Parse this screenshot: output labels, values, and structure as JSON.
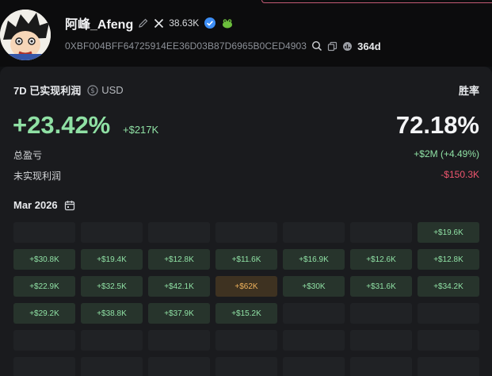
{
  "profile": {
    "name": "阿峰_Afeng",
    "followers": "38.63K",
    "address": "0XBF004BFF64725914EE36D03B87D6965B0CED4903",
    "age": "364d"
  },
  "summary": {
    "period_label": "7D 已实现利润",
    "currency": "USD",
    "pnl_percent": "+23.42%",
    "pnl_amount": "+$217K",
    "winrate_label": "胜率",
    "winrate": "72.18%",
    "total_label": "总盈亏",
    "total_value": "+$2M (+4.49%)",
    "unrealized_label": "未实现利润",
    "unrealized_value": "-$150.3K"
  },
  "calendar": {
    "month": "Mar 2026",
    "cells": [
      {
        "value": ""
      },
      {
        "value": ""
      },
      {
        "value": ""
      },
      {
        "value": ""
      },
      {
        "value": ""
      },
      {
        "value": ""
      },
      {
        "value": "+$19.6K"
      },
      {
        "value": "+$30.8K"
      },
      {
        "value": "+$19.4K"
      },
      {
        "value": "+$12.8K"
      },
      {
        "value": "+$11.6K"
      },
      {
        "value": "+$16.9K"
      },
      {
        "value": "+$12.6K"
      },
      {
        "value": "+$12.8K"
      },
      {
        "value": "+$22.9K"
      },
      {
        "value": "+$32.5K"
      },
      {
        "value": "+$42.1K"
      },
      {
        "value": "+$62K"
      },
      {
        "value": "+$30K"
      },
      {
        "value": "+$31.6K"
      },
      {
        "value": "+$34.2K"
      },
      {
        "value": "+$29.2K"
      },
      {
        "value": "+$38.8K"
      },
      {
        "value": "+$37.9K"
      },
      {
        "value": "+$15.2K"
      },
      {
        "value": ""
      },
      {
        "value": ""
      },
      {
        "value": ""
      },
      {
        "value": ""
      },
      {
        "value": ""
      },
      {
        "value": ""
      },
      {
        "value": ""
      },
      {
        "value": ""
      },
      {
        "value": ""
      },
      {
        "value": ""
      },
      {
        "value": ""
      },
      {
        "value": ""
      },
      {
        "value": ""
      },
      {
        "value": ""
      },
      {
        "value": ""
      },
      {
        "value": ""
      },
      {
        "value": ""
      }
    ]
  },
  "colors": {
    "positive": "#8fe0a4",
    "negative": "#f0566f",
    "highlight": "#f0b35c"
  }
}
